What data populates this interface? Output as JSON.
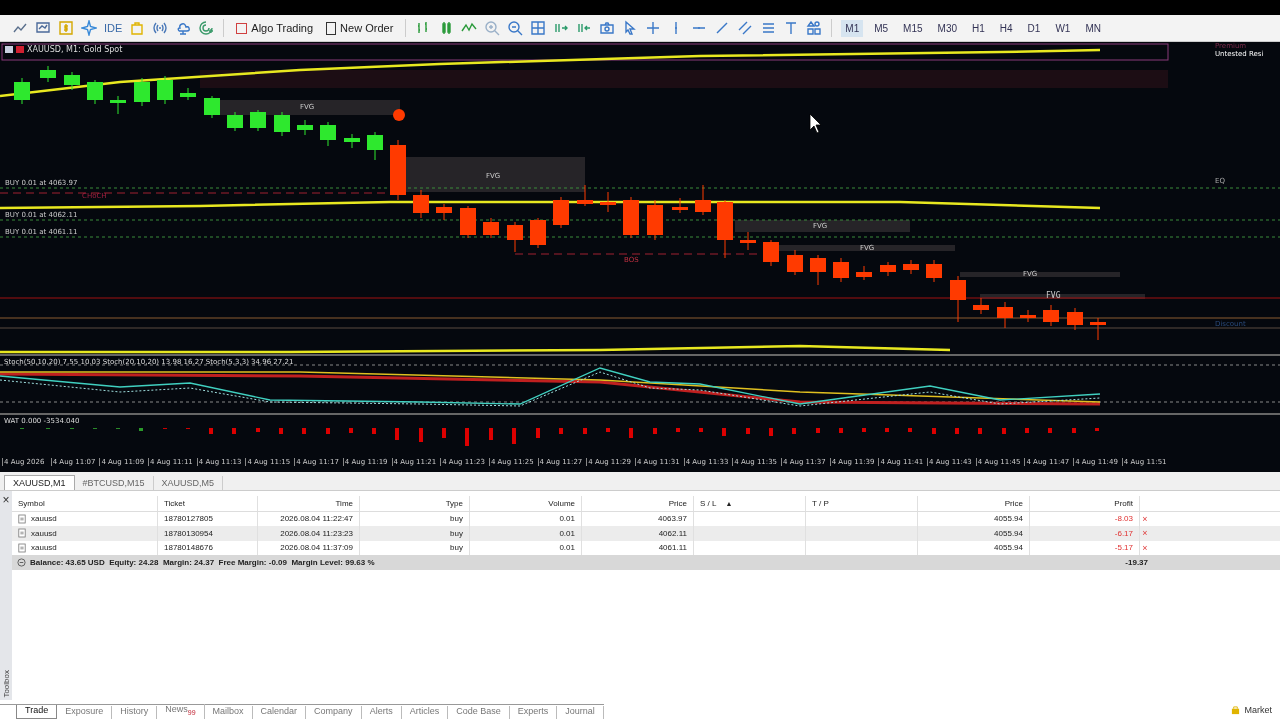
{
  "toolbar": {
    "ide_label": "IDE",
    "buttons": [
      {
        "label": "Algo Trading"
      },
      {
        "label": "New Order"
      }
    ],
    "timeframes": [
      {
        "label": "M1",
        "selected": true
      },
      {
        "label": "M5",
        "selected": false
      },
      {
        "label": "M15",
        "selected": false
      },
      {
        "label": "M30",
        "selected": false
      },
      {
        "label": "H1",
        "selected": false
      },
      {
        "label": "H4",
        "selected": false
      },
      {
        "label": "D1",
        "selected": false
      },
      {
        "label": "W1",
        "selected": false
      },
      {
        "label": "MN",
        "selected": false
      }
    ]
  },
  "chart": {
    "title": "XAUUSD, M1:  Gold Spot",
    "order_lines": [
      "BUY 0.01 at 4063.97",
      "BUY 0.01 at 4062.11",
      "BUY 0.01 at 4061.11"
    ],
    "labels": [
      "Premium",
      "Untested Resi",
      "FVG",
      "FVG",
      "EQ",
      "CHoCH",
      "FVG",
      "FVG",
      "BOS",
      "FVG",
      "FVG",
      "Discount"
    ],
    "stoch_label": "Stoch(50,10,20) 7.55 10.03 Stoch(20,10,20) 13.98 16.27 Stoch(5,3,3) 34.96 27.21",
    "wat_label": "WAT 0.000 -3534.040",
    "time_axis": [
      "4 Aug 2026",
      "4 Aug 11:07",
      "4 Aug 11:09",
      "4 Aug 11:11",
      "4 Aug 11:13",
      "4 Aug 11:15",
      "4 Aug 11:17",
      "4 Aug 11:19",
      "4 Aug 11:21",
      "4 Aug 11:23",
      "4 Aug 11:25",
      "4 Aug 11:27",
      "4 Aug 11:29",
      "4 Aug 11:31",
      "4 Aug 11:33",
      "4 Aug 11:35",
      "4 Aug 11:37",
      "4 Aug 11:39",
      "4 Aug 11:41",
      "4 Aug 11:43",
      "4 Aug 11:45",
      "4 Aug 11:47",
      "4 Aug 11:49",
      "4 Aug 11:51"
    ]
  },
  "chart_tabs": [
    {
      "label": "XAUUSD,M1",
      "selected": true
    },
    {
      "label": "#BTCUSD,M15",
      "selected": false
    },
    {
      "label": "XAUUSD,M5",
      "selected": false
    }
  ],
  "table": {
    "columns": [
      "Symbol",
      "Ticket",
      "Time",
      "Type",
      "Volume",
      "Price",
      "S / L",
      "T / P",
      "Price",
      "Profit"
    ],
    "sort_mark": "▲",
    "rows": [
      {
        "cells": [
          "xauusd",
          "18780127805",
          "2026.08.04 11:22:47",
          "buy",
          "0.01",
          "4063.97",
          "",
          "",
          "4055.94",
          "-8.03"
        ],
        "close": "×",
        "selected": false
      },
      {
        "cells": [
          "xauusd",
          "18780130954",
          "2026.08.04 11:23:23",
          "buy",
          "0.01",
          "4062.11",
          "",
          "",
          "4055.94",
          "-6.17"
        ],
        "close": "×",
        "selected": true
      },
      {
        "cells": [
          "xauusd",
          "18780148676",
          "2026.08.04 11:37:09",
          "buy",
          "0.01",
          "4061.11",
          "",
          "",
          "4055.94",
          "-5.17"
        ],
        "close": "×",
        "selected": false
      }
    ],
    "summary": "Balance: 43.65 USD  Equity: 24.28  Margin: 24.37  Free Margin: -0.09  Margin Level: 99.63 %",
    "summary_profit": "-19.37"
  },
  "bottom_tabs": [
    {
      "label": "Trade",
      "selected": true
    },
    {
      "label": "Exposure",
      "selected": false
    },
    {
      "label": "History",
      "selected": false
    },
    {
      "label": "News",
      "selected": false,
      "badge": "99"
    },
    {
      "label": "Mailbox",
      "selected": false
    },
    {
      "label": "Calendar",
      "selected": false
    },
    {
      "label": "Company",
      "selected": false
    },
    {
      "label": "Alerts",
      "selected": false
    },
    {
      "label": "Articles",
      "selected": false
    },
    {
      "label": "Code Base",
      "selected": false
    },
    {
      "label": "Experts",
      "selected": false
    },
    {
      "label": "Journal",
      "selected": false
    }
  ],
  "toolbox_label": "Toolbox",
  "toolbox_close": "×",
  "market_label": "Market"
}
